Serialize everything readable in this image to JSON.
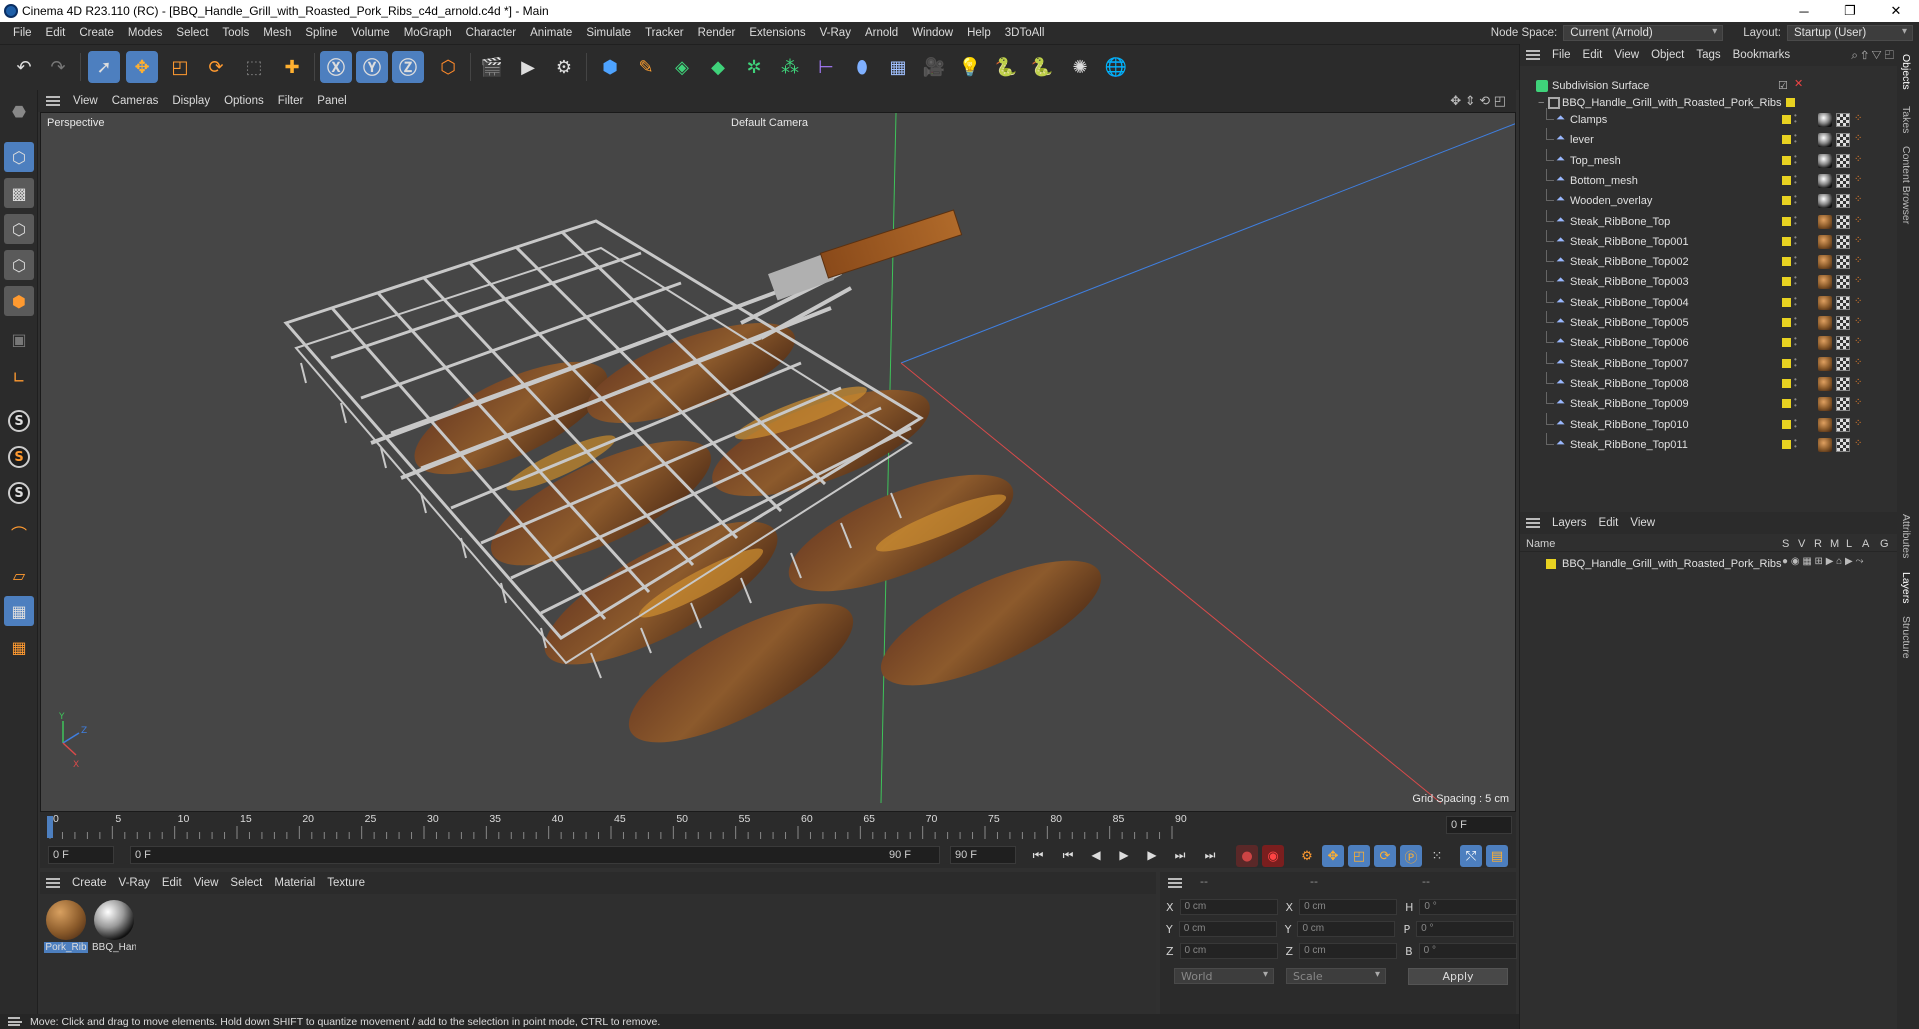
{
  "window": {
    "title": "Cinema 4D R23.110 (RC) - [BBQ_Handle_Grill_with_Roasted_Pork_Ribs_c4d_arnold.c4d *] - Main",
    "minimize": "─",
    "maximize": "❐",
    "close": "✕"
  },
  "menu": [
    "File",
    "Edit",
    "Create",
    "Modes",
    "Select",
    "Tools",
    "Mesh",
    "Spline",
    "Volume",
    "MoGraph",
    "Character",
    "Animate",
    "Simulate",
    "Tracker",
    "Render",
    "Extensions",
    "V-Ray",
    "Arnold",
    "Window",
    "Help",
    "3DToAll"
  ],
  "node_space": {
    "label": "Node Space:",
    "value": "Current (Arnold)"
  },
  "layout": {
    "label": "Layout:",
    "value": "Startup (User)"
  },
  "viewport_menu": [
    "View",
    "Cameras",
    "Display",
    "Options",
    "Filter",
    "Panel"
  ],
  "viewport": {
    "projection": "Perspective",
    "camera": "Default Camera",
    "grid_spacing": "Grid Spacing : 5 cm"
  },
  "timeline": {
    "ticks": [
      "0",
      "5",
      "10",
      "15",
      "20",
      "25",
      "30",
      "35",
      "40",
      "45",
      "50",
      "55",
      "60",
      "65",
      "70",
      "75",
      "80",
      "85",
      "90"
    ],
    "current_frame": "0 F",
    "start_frame": "0 F",
    "range_start": "0 F",
    "range_end": "90 F",
    "end_frame": "90 F",
    "right_frame": "0 F"
  },
  "material_menu": [
    "Create",
    "V-Ray",
    "Edit",
    "View",
    "Select",
    "Material",
    "Texture"
  ],
  "materials": [
    {
      "label": "Pork_Rib",
      "color": "#8a5a2a"
    },
    {
      "label": "BBQ_Han",
      "color": "#cfcfcf"
    }
  ],
  "coords": {
    "headers": [
      "--",
      "--",
      "--"
    ],
    "rows": [
      {
        "a": "X",
        "av": "0 cm",
        "b": "X",
        "bv": "0 cm",
        "c": "H",
        "cv": "0 °"
      },
      {
        "a": "Y",
        "av": "0 cm",
        "b": "Y",
        "bv": "0 cm",
        "c": "P",
        "cv": "0 °"
      },
      {
        "a": "Z",
        "av": "0 cm",
        "b": "Z",
        "bv": "0 cm",
        "c": "B",
        "cv": "0 °"
      }
    ],
    "world": "World",
    "scale": "Scale",
    "apply": "Apply"
  },
  "status": "Move: Click and drag to move elements. Hold down SHIFT to quantize movement / add to the selection in point mode, CTRL to remove.",
  "object_menu": [
    "File",
    "Edit",
    "View",
    "Object",
    "Tags",
    "Bookmarks"
  ],
  "objects": {
    "root": "Subdivision Surface",
    "group": "BBQ_Handle_Grill_with_Roasted_Pork_Ribs",
    "children": [
      "Clamps",
      "lever",
      "Top_mesh",
      "Bottom_mesh",
      "Wooden_overlay",
      "Steak_RibBone_Top",
      "Steak_RibBone_Top001",
      "Steak_RibBone_Top002",
      "Steak_RibBone_Top003",
      "Steak_RibBone_Top004",
      "Steak_RibBone_Top005",
      "Steak_RibBone_Top006",
      "Steak_RibBone_Top007",
      "Steak_RibBone_Top008",
      "Steak_RibBone_Top009",
      "Steak_RibBone_Top010",
      "Steak_RibBone_Top011"
    ],
    "metal_count": 5
  },
  "layer_menu": [
    "Layers",
    "Edit",
    "View"
  ],
  "layer_header": {
    "name": "Name",
    "cols": [
      "S",
      "V",
      "R",
      "M",
      "L",
      "A",
      "G"
    ]
  },
  "layers": [
    {
      "name": "BBQ_Handle_Grill_with_Roasted_Pork_Ribs",
      "color": "#e8d221"
    }
  ],
  "side_tabs": [
    "Objects",
    "Takes",
    "Content Browser",
    "Attributes",
    "Layers",
    "Structure"
  ],
  "colors": {
    "accent": "#4d7fbf",
    "layer_yellow": "#e8d221",
    "axis_x": "#d84a4a",
    "axis_y": "#3ec35a",
    "axis_z": "#3f7fe0"
  }
}
